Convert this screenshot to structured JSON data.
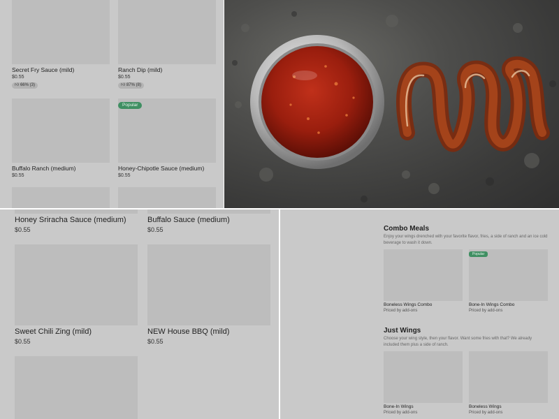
{
  "panel_top_left": {
    "items": [
      {
        "name": "Secret Fry Sauce (mild)",
        "price": "$0.55",
        "rating": "66% (3)"
      },
      {
        "name": "Ranch Dip (mild)",
        "price": "$0.55",
        "rating": "87% (8)"
      },
      {
        "name": "Buffalo Ranch (medium)",
        "price": "$0.55"
      },
      {
        "name": "Honey-Chipotle Sauce (medium)",
        "price": "$0.55",
        "badge": "Popular"
      }
    ]
  },
  "photo": {
    "description_icon": "sauce-cup-photo"
  },
  "panel_bottom_left": {
    "items": [
      {
        "name": "Honey Sriracha Sauce (medium)",
        "price": "$0.55"
      },
      {
        "name": "Buffalo Sauce (medium)",
        "price": "$0.55"
      },
      {
        "name": "Sweet Chili Zing (mild)",
        "price": "$0.55"
      },
      {
        "name": "NEW House BBQ (mild)",
        "price": "$0.55"
      }
    ]
  },
  "panel_bottom_right": {
    "combo": {
      "title": "Combo Meals",
      "description": "Enjoy your wings drenched with your favorite flavor, fries, a side of ranch and an ice cold beverage to wash it down.",
      "items": [
        {
          "name": "Boneless Wings Combo",
          "price": "Priced by add-ons"
        },
        {
          "name": "Bone-In Wings Combo",
          "price": "Priced by add-ons",
          "badge": "Popular"
        }
      ]
    },
    "just_wings": {
      "title": "Just Wings",
      "description": "Choose your wing style, then your flavor. Want some fries with that? We already included them plus a side of ranch.",
      "items": [
        {
          "name": "Bone-In Wings",
          "price": "Priced by add-ons"
        },
        {
          "name": "Boneless Wings",
          "price": "Priced by add-ons"
        }
      ]
    }
  },
  "colors": {
    "panel_bg": "#c9c9c9",
    "placeholder": "#bdbdbd",
    "badge_green": "#3f8f62",
    "divider": "#ffffff"
  },
  "icons": {
    "rating": "thumbs-up-icon"
  }
}
